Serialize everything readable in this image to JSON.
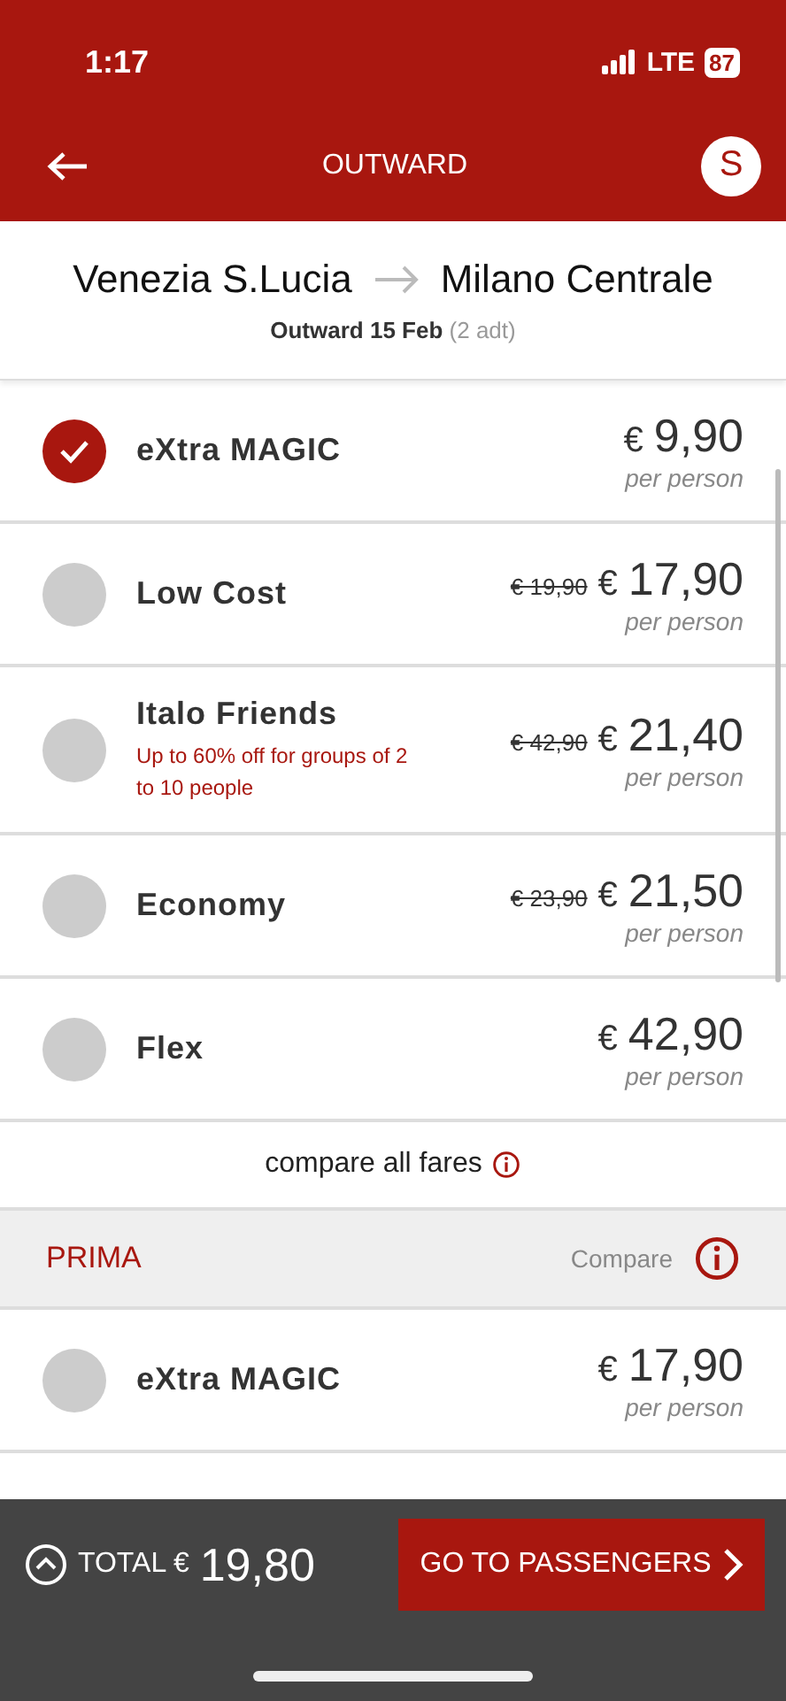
{
  "status_bar": {
    "time": "1:17",
    "network": "LTE",
    "battery": "87"
  },
  "nav": {
    "title": "OUTWARD",
    "avatar": "S"
  },
  "route": {
    "from": "Venezia S.Lucia",
    "to": "Milano Centrale",
    "date_label": "Outward 15 Feb",
    "passengers": "(2 adt)"
  },
  "fares": [
    {
      "name": "eXtra MAGIC",
      "selected": true,
      "currency": "€",
      "amount": "9,90",
      "unit": "per person"
    },
    {
      "name": "Low Cost",
      "selected": false,
      "old_price": "€ 19,90",
      "currency": "€",
      "amount": "17,90",
      "unit": "per person"
    },
    {
      "name": "Italo Friends",
      "note": "Up to 60% off for groups of 2 to 10 people",
      "selected": false,
      "old_price": "€ 42,90",
      "currency": "€",
      "amount": "21,40",
      "unit": "per person"
    },
    {
      "name": "Economy",
      "selected": false,
      "old_price": "€ 23,90",
      "currency": "€",
      "amount": "21,50",
      "unit": "per person"
    },
    {
      "name": "Flex",
      "selected": false,
      "currency": "€",
      "amount": "42,90",
      "unit": "per person"
    }
  ],
  "compare_link": "compare all fares",
  "prima": {
    "title": "PRIMA",
    "compare": "Compare",
    "fares": [
      {
        "name": "eXtra MAGIC",
        "selected": false,
        "currency": "€",
        "amount": "17,90",
        "unit": "per person"
      }
    ]
  },
  "footer": {
    "total_label": "TOTAL €",
    "total": "19,80",
    "button": "GO TO PASSENGERS"
  }
}
